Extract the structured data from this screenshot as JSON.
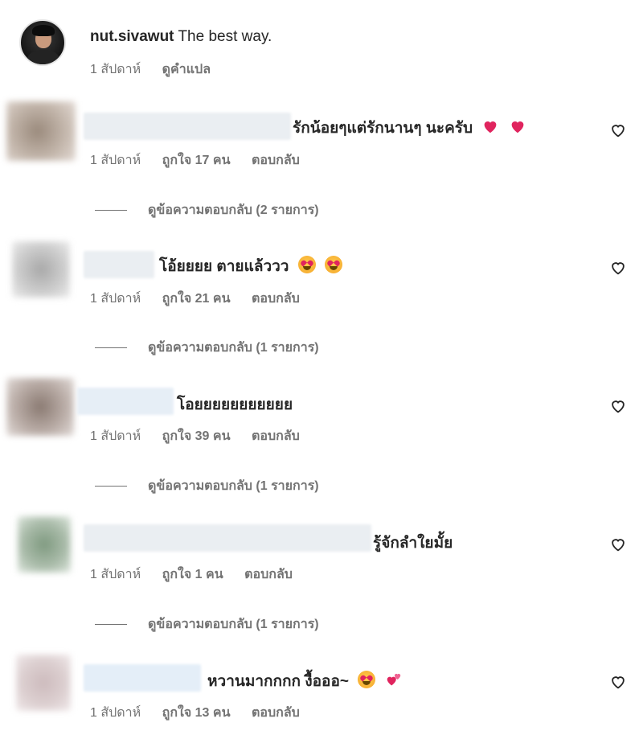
{
  "post": {
    "username": "nut.sivawut",
    "caption": "The best way.",
    "time": "1 สัปดาห์",
    "translate_label": "ดูคำแปล"
  },
  "labels": {
    "reply": "ตอบกลับ"
  },
  "comments": [
    {
      "text": "รักน้อยๆแต่รักนานๆ นะครับ",
      "time": "1 สัปดาห์",
      "likes": "ถูกใจ 17 คน",
      "replies": "ดูข้อความตอบกลับ (2 รายการ)",
      "emoji": [
        "red-heart",
        "red-heart"
      ]
    },
    {
      "text": "โอ้ยยยย ตายแล้ววว",
      "time": "1 สัปดาห์",
      "likes": "ถูกใจ 21 คน",
      "replies": "ดูข้อความตอบกลับ (1 รายการ)",
      "emoji": [
        "heart-eyes",
        "heart-eyes"
      ]
    },
    {
      "text": "โอยยยยยยยยยยย",
      "time": "1 สัปดาห์",
      "likes": "ถูกใจ 39 คน",
      "replies": "ดูข้อความตอบกลับ (1 รายการ)",
      "emoji": []
    },
    {
      "text": "รู้จักลำใยมั้ย",
      "time": "1 สัปดาห์",
      "likes": "ถูกใจ 1 คน",
      "replies": "ดูข้อความตอบกลับ (1 รายการ)",
      "emoji": []
    },
    {
      "text": "หวานมากกกก งื้อออ~",
      "time": "1 สัปดาห์",
      "likes": "ถูกใจ 13 คน",
      "emoji": [
        "heart-eyes",
        "two-hearts"
      ]
    }
  ],
  "colors": {
    "text": "#262626",
    "meta": "#737373",
    "heart": "#e0245e"
  }
}
